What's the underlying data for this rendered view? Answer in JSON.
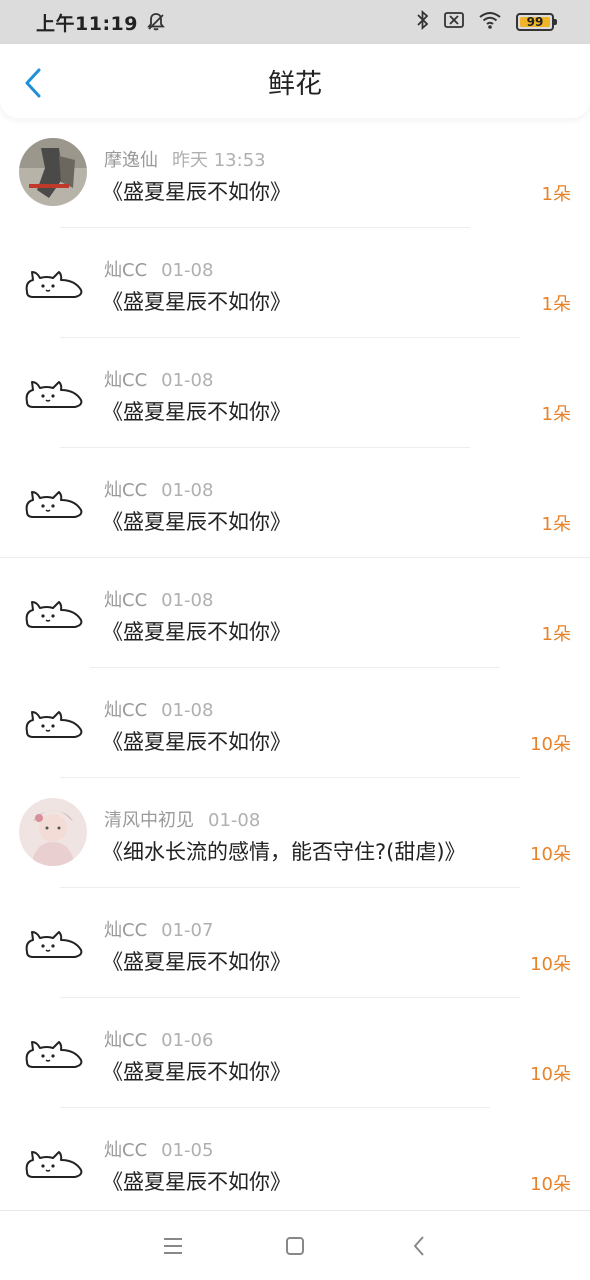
{
  "statusbar": {
    "time": "上午11:19",
    "battery": "99",
    "battery_level": 0.99
  },
  "header": {
    "title": "鲜花"
  },
  "items": [
    {
      "name": "摩逸仙",
      "date": "昨天 13:53",
      "book": "《盛夏星辰不如你》",
      "count": "1朵",
      "avatar": "photo-avatar-1"
    },
    {
      "name": "灿CC",
      "date": "01-08",
      "book": "《盛夏星辰不如你》",
      "count": "1朵",
      "avatar": "cat-sketch"
    },
    {
      "name": "灿CC",
      "date": "01-08",
      "book": "《盛夏星辰不如你》",
      "count": "1朵",
      "avatar": "cat-sketch"
    },
    {
      "name": "灿CC",
      "date": "01-08",
      "book": "《盛夏星辰不如你》",
      "count": "1朵",
      "avatar": "cat-sketch"
    },
    {
      "name": "灿CC",
      "date": "01-08",
      "book": "《盛夏星辰不如你》",
      "count": "1朵",
      "avatar": "cat-sketch"
    },
    {
      "name": "灿CC",
      "date": "01-08",
      "book": "《盛夏星辰不如你》",
      "count": "10朵",
      "avatar": "cat-sketch"
    },
    {
      "name": "清风中初见",
      "date": "01-08",
      "book": "《细水长流的感情，能否守住?(甜虐)》",
      "count": "10朵",
      "avatar": "photo-avatar-2"
    },
    {
      "name": "灿CC",
      "date": "01-07",
      "book": "《盛夏星辰不如你》",
      "count": "10朵",
      "avatar": "cat-sketch"
    },
    {
      "name": "灿CC",
      "date": "01-06",
      "book": "《盛夏星辰不如你》",
      "count": "10朵",
      "avatar": "cat-sketch"
    },
    {
      "name": "灿CC",
      "date": "01-05",
      "book": "《盛夏星辰不如你》",
      "count": "10朵",
      "avatar": "cat-sketch"
    }
  ],
  "colors": {
    "accent": "#1e90d6",
    "count": "#e8822a",
    "statusbar_bg": "#dcdcdc"
  }
}
